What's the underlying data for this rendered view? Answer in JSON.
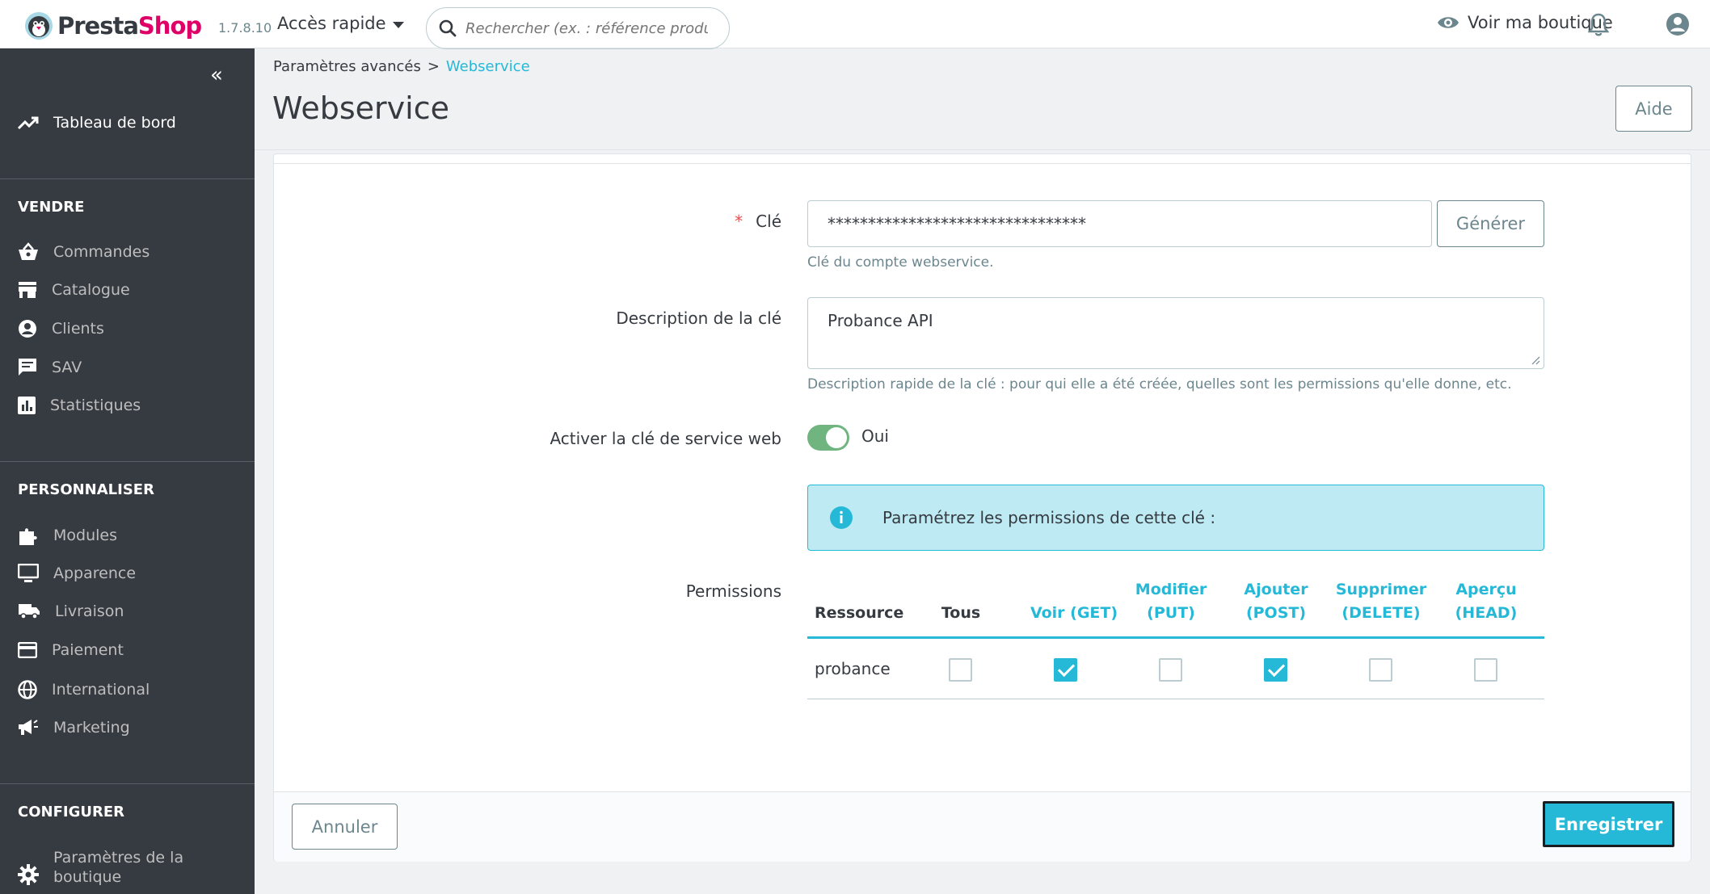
{
  "header": {
    "logo_part1": "Presta",
    "logo_part2": "Shop",
    "version": "1.7.8.10",
    "quick_access": "Accès rapide",
    "search_placeholder": "Rechercher (ex. : référence produit, no",
    "view_shop": "Voir ma boutique"
  },
  "sidebar": {
    "dashboard": "Tableau de bord",
    "sections": [
      "VENDRE",
      "PERSONNALISER",
      "CONFIGURER"
    ],
    "sell_items": [
      {
        "label": "Commandes",
        "icon": "basket-icon"
      },
      {
        "label": "Catalogue",
        "icon": "store-icon"
      },
      {
        "label": "Clients",
        "icon": "user-circle-icon"
      },
      {
        "label": "SAV",
        "icon": "chat-icon"
      },
      {
        "label": "Statistiques",
        "icon": "stats-icon"
      }
    ],
    "customize_items": [
      {
        "label": "Modules",
        "icon": "puzzle-icon"
      },
      {
        "label": "Apparence",
        "icon": "monitor-icon"
      },
      {
        "label": "Livraison",
        "icon": "truck-icon"
      },
      {
        "label": "Paiement",
        "icon": "card-icon"
      },
      {
        "label": "International",
        "icon": "globe-icon"
      },
      {
        "label": "Marketing",
        "icon": "megaphone-icon"
      }
    ],
    "configure_items": [
      {
        "label_line1": "Paramètres de la",
        "label_line2": "boutique",
        "icon": "gear-icon"
      }
    ]
  },
  "breadcrumb": {
    "parent": "Paramètres avancés",
    "separator": ">",
    "current": "Webservice"
  },
  "page": {
    "title": "Webservice",
    "help_button": "Aide"
  },
  "form": {
    "key_required_mark": "*",
    "key_label": "Clé",
    "key_value": "********************************",
    "generate_button": "Générer",
    "key_help": "Clé du compte webservice.",
    "description_label": "Description de la clé",
    "description_value": "Probance API",
    "description_help": "Description rapide de la clé : pour qui elle a été créée, quelles sont les permissions qu'elle donne, etc.",
    "enable_label": "Activer la clé de service web",
    "enable_value": "Oui",
    "alert_text": "Paramétrez les permissions de cette clé :",
    "permissions_label": "Permissions"
  },
  "permissions": {
    "headers": {
      "resource": "Ressource",
      "all": "Tous",
      "get": "Voir (GET)",
      "put_1": "Modifier",
      "put_2": "(PUT)",
      "post_1": "Ajouter",
      "post_2": "(POST)",
      "delete_1": "Supprimer",
      "delete_2": "(DELETE)",
      "head_1": "Aperçu",
      "head_2": "(HEAD)"
    },
    "rows": [
      {
        "resource": "probance",
        "all": false,
        "get": true,
        "put": false,
        "post": true,
        "delete": false,
        "head": false
      }
    ]
  },
  "footer": {
    "cancel_button": "Annuler",
    "save_button": "Enregistrer"
  },
  "colors": {
    "accent": "#25b9d7",
    "brand_pink": "#df0067",
    "sidebar_bg": "#363a41",
    "toggle_on": "#70b580"
  }
}
